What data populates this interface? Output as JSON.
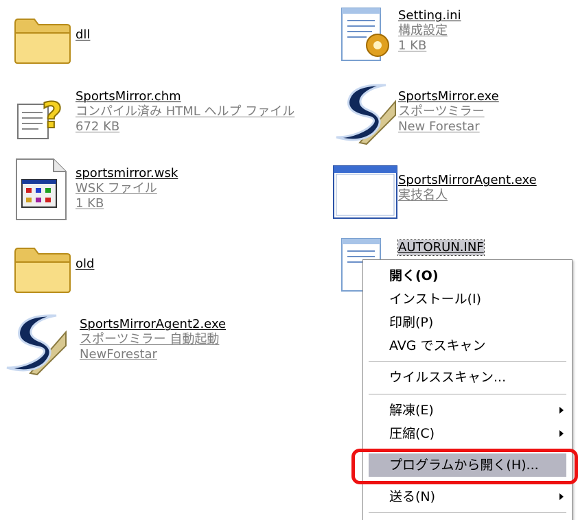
{
  "files": [
    {
      "id": "dll",
      "name": "dll",
      "sub": []
    },
    {
      "id": "setting-ini",
      "name": "Setting.ini",
      "sub": [
        "構成設定",
        "1 KB"
      ]
    },
    {
      "id": "sportsmirror-chm",
      "name": "SportsMirror.chm",
      "sub": [
        "コンパイル済み HTML ヘルプ ファイル",
        "672 KB"
      ]
    },
    {
      "id": "sportsmirror-exe",
      "name": "SportsMirror.exe",
      "sub": [
        "スポーツミラー",
        "New Forestar"
      ]
    },
    {
      "id": "sportsmirror-wsk",
      "name": "sportsmirror.wsk",
      "sub": [
        "WSK ファイル",
        "1 KB"
      ]
    },
    {
      "id": "sportsmirroragent-exe",
      "name": "SportsMirrorAgent.exe",
      "sub": [
        "実技名人"
      ]
    },
    {
      "id": "old",
      "name": "old",
      "sub": []
    },
    {
      "id": "autorun-inf",
      "name": "AUTORUN.INF",
      "sub": []
    },
    {
      "id": "sportsmirroragent2-exe",
      "name": "SportsMirrorAgent2.exe",
      "sub": [
        "スポーツミラー 自動起動",
        "NewForestar"
      ]
    }
  ],
  "context_menu": {
    "items": [
      {
        "label": "開く(O)",
        "bold": true,
        "submenu": false
      },
      {
        "label": "インストール(I)",
        "bold": false,
        "submenu": false
      },
      {
        "label": "印刷(P)",
        "bold": false,
        "submenu": false
      },
      {
        "label": "AVG でスキャン",
        "bold": false,
        "submenu": false
      },
      {
        "label": "ウイルススキャン...",
        "bold": false,
        "submenu": false
      },
      {
        "label": "解凍(E)",
        "bold": false,
        "submenu": true
      },
      {
        "label": "圧縮(C)",
        "bold": false,
        "submenu": true
      },
      {
        "label": "プログラムから開く(H)...",
        "bold": false,
        "submenu": false,
        "hovered": true
      },
      {
        "label": "送る(N)",
        "bold": false,
        "submenu": true
      }
    ]
  },
  "colors": {
    "callout": "#ee1111",
    "hover": "#b6b6c2",
    "subtext": "#7d7d7d"
  }
}
